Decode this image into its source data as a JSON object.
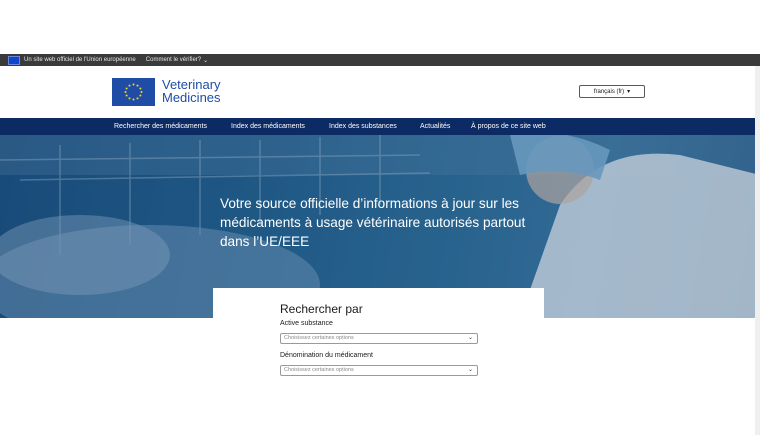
{
  "eu_bar": {
    "official_text": "Un site web officiel de l'Union européenne",
    "verify_text": "Comment le vérifier?",
    "verify_chevron": "⌄"
  },
  "header": {
    "logo_line1": "Veterinary",
    "logo_line2": "Medicines",
    "language": "français (fr)",
    "language_caret": "▾"
  },
  "nav": {
    "items": [
      "Rechercher des médicaments",
      "Index des médicaments",
      "Index des substances",
      "Actualités",
      "À propos de ce site web"
    ]
  },
  "hero": {
    "headline": "Votre source officielle d’informations à jour sur les médicaments à usage vétérinaire autorisés partout dans l’UE/EEE"
  },
  "search": {
    "title": "Rechercher par",
    "active_substance_label": "Active substance",
    "active_substance_placeholder": "Choisissez certaines options",
    "denomination_label": "Dénomination du médicament",
    "denomination_placeholder": "Choisissez certaines options",
    "dropdown_chevron": "⌄"
  },
  "colors": {
    "eu_bar": "#3a3a3a",
    "nav": "#0c2a63",
    "brand_blue": "#1f4da6",
    "hero": "#24618f"
  },
  "icons": [
    "eu-flag-icon",
    "chevron-down-icon",
    "caret-down-icon"
  ]
}
